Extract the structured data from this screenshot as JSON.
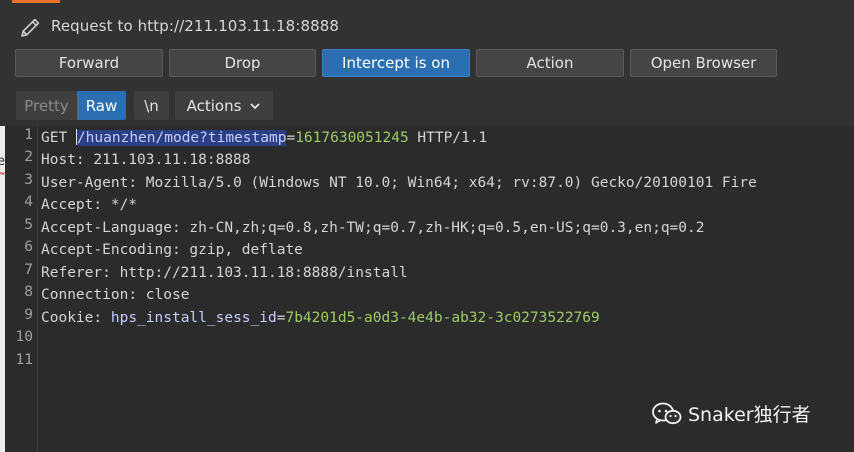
{
  "header": {
    "title": "Request to http://211.103.11.18:8888",
    "accent_color": "#e8742b"
  },
  "buttons": {
    "forward": "Forward",
    "drop": "Drop",
    "intercept": "Intercept is on",
    "action": "Action",
    "open_browser": "Open Browser"
  },
  "view_tabs": {
    "pretty": "Pretty",
    "raw": "Raw",
    "newline": "\\n",
    "actions": "Actions"
  },
  "left_fragment": "e",
  "line_numbers": [
    "1",
    "2",
    "3",
    "4",
    "5",
    "6",
    "7",
    "8",
    "9",
    "10",
    "11"
  ],
  "request": {
    "method": "GET",
    "path": "/huanzhen/mode?timestamp",
    "eq": "=",
    "timestamp_value": "1617630051245",
    "protocol": " HTTP/1.1",
    "host_key": "Host",
    "host_val": ": 211.103.11.18:8888",
    "ua_key": "User-Agent",
    "ua_val": ": Mozilla/5.0 (Windows NT 10.0; Win64; x64; rv:87.0) Gecko/20100101 Fire",
    "accept_key": "Accept",
    "accept_val": ": */*",
    "lang_key": "Accept-Language",
    "lang_val": ": zh-CN,zh;q=0.8,zh-TW;q=0.7,zh-HK;q=0.5,en-US;q=0.3,en;q=0.2",
    "enc_key": "Accept-Encoding",
    "enc_val": ": gzip, deflate",
    "referer_key": "Referer",
    "referer_val": ": http://211.103.11.18:8888/install",
    "conn_key": "Connection",
    "conn_val": ": close",
    "cookie_key": "Cookie",
    "cookie_sep": ": ",
    "cookie_name": "hps_install_sess_id",
    "cookie_eq": "=",
    "cookie_val": "7b4201d5-a0d3-4e4b-ab32-3c0273522769"
  },
  "watermark": {
    "text": "Snaker独行者",
    "icon": "wechat-icon"
  },
  "colors": {
    "selected_button": "#2b6fb2",
    "value_green": "#9ccc65",
    "selection_bg": "#2b3f85"
  }
}
